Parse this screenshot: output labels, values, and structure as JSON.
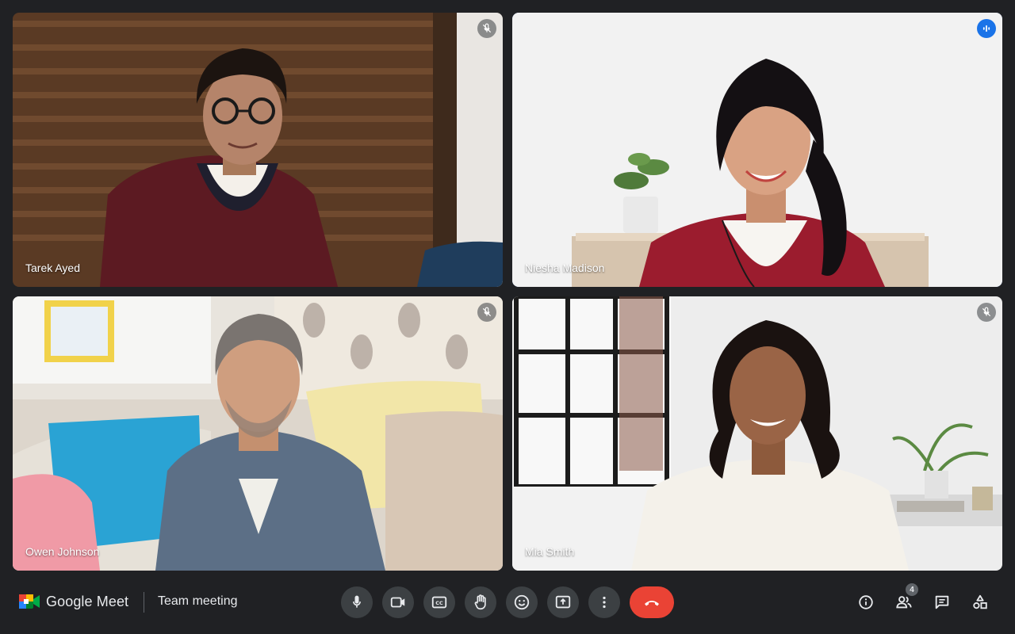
{
  "app": {
    "brand": "Google Meet",
    "meeting_title": "Team meeting"
  },
  "participants": [
    {
      "name": "Tarek Ayed",
      "status": "muted"
    },
    {
      "name": "Niesha Madison",
      "status": "speaking"
    },
    {
      "name": "Owen Johnson",
      "status": "muted"
    },
    {
      "name": "Mia Smith",
      "status": "muted"
    }
  ],
  "controls": [
    {
      "id": "mic",
      "icon": "mic-icon"
    },
    {
      "id": "camera",
      "icon": "camera-icon"
    },
    {
      "id": "captions",
      "icon": "captions-icon",
      "glyph": "CC"
    },
    {
      "id": "raise-hand",
      "icon": "hand-icon"
    },
    {
      "id": "reactions",
      "icon": "emoji-icon"
    },
    {
      "id": "present",
      "icon": "present-screen-icon"
    },
    {
      "id": "more",
      "icon": "more-vert-icon"
    },
    {
      "id": "leave",
      "icon": "call-end-icon"
    }
  ],
  "right_actions": {
    "info_icon": "info-icon",
    "people_icon": "people-icon",
    "people_count": "4",
    "chat_icon": "chat-icon",
    "activities_icon": "activities-icon"
  },
  "colors": {
    "accent": "#1a73e8",
    "active_border": "#669df6",
    "end_call": "#ea4335",
    "background": "#202124"
  }
}
